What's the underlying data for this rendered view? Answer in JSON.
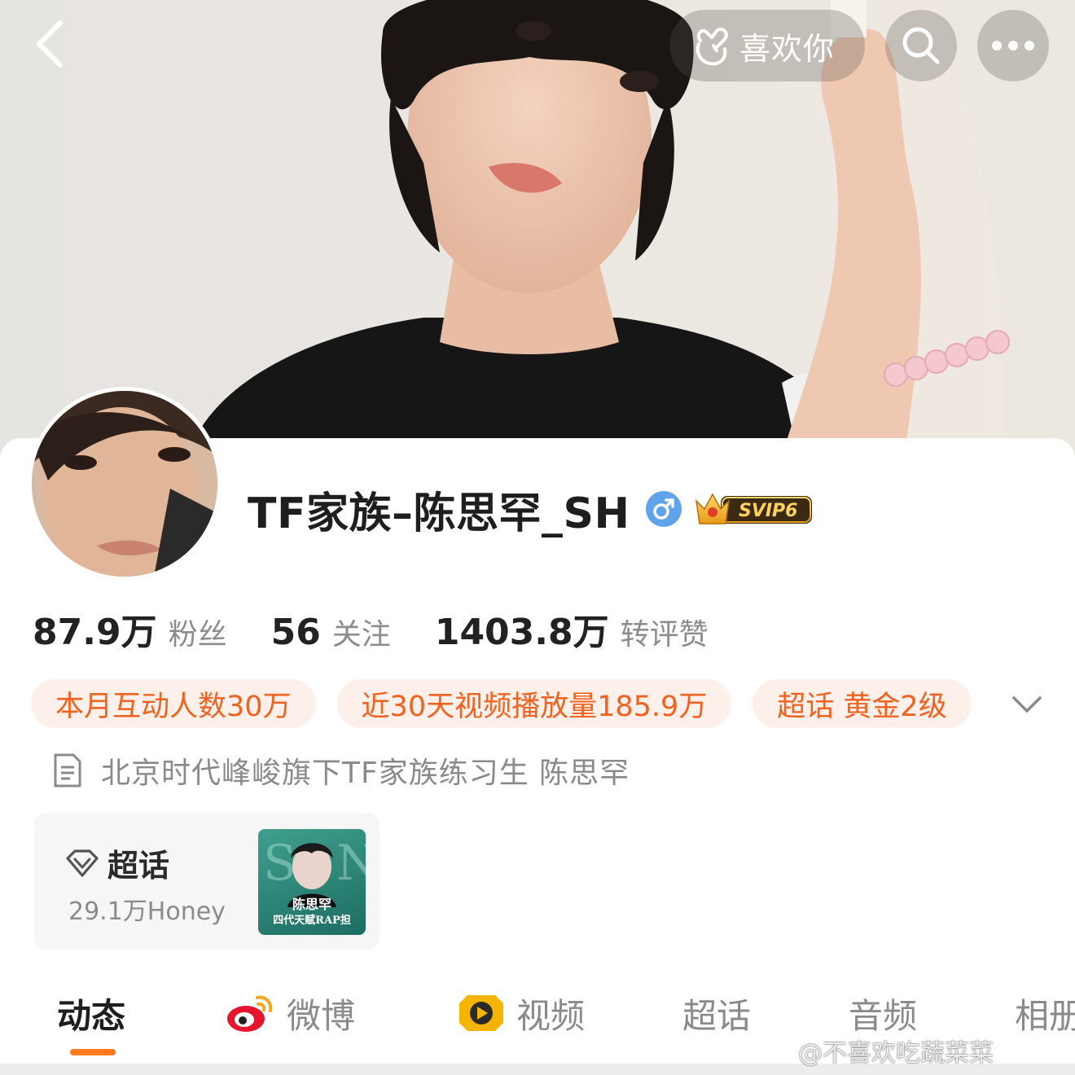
{
  "header": {
    "like_label": "喜欢你"
  },
  "profile": {
    "name": "TF家族–陈思罕_SH",
    "gender": "male",
    "vip_badge": "SVIP6"
  },
  "stats": [
    {
      "value": "87.9万",
      "label": "粉丝"
    },
    {
      "value": "56",
      "label": "关注"
    },
    {
      "value": "1403.8万",
      "label": "转评赞"
    }
  ],
  "tags": [
    "本月互动人数30万",
    "近30天视频播放量185.9万",
    "超话 黄金2级"
  ],
  "bio": "北京时代峰峻旗下TF家族练习生 陈思罕",
  "supertopic": {
    "title": "超话",
    "count": "29.1万Honey",
    "cover_title": "陈思罕",
    "cover_subtitle": "四代天赋RAP担"
  },
  "tabs": [
    {
      "label": "动态",
      "icon": null,
      "active": true
    },
    {
      "label": "微博",
      "icon": "weibo-logo-icon",
      "active": false
    },
    {
      "label": "视频",
      "icon": "video-play-icon",
      "active": false
    },
    {
      "label": "超话",
      "icon": null,
      "active": false
    },
    {
      "label": "音频",
      "icon": null,
      "active": false
    },
    {
      "label": "相册",
      "icon": null,
      "active": false
    }
  ],
  "watermark": "@不喜欢吃蔬菜菜",
  "colors": {
    "accent": "#f0621f",
    "tag_bg": "#fdf0ea",
    "tab_underline": "#ff7a1f",
    "gender_badge": "#5fa3ea"
  }
}
